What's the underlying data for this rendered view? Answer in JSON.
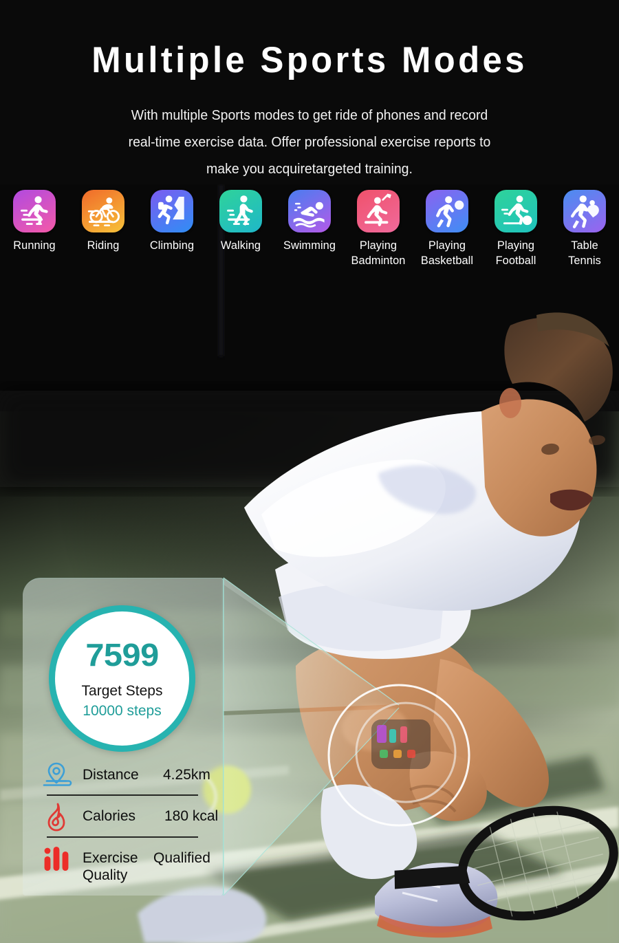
{
  "header": {
    "title": "Multiple Sports Modes",
    "subtitle_lines": [
      "With multiple Sports modes to get ride of phones and record",
      "real-time exercise data. Offer professional exercise reports to",
      "make you acquiretargeted training."
    ]
  },
  "sports": [
    {
      "label": "Running",
      "icon": "running-icon",
      "gradient_from": "#b14ae0",
      "gradient_to": "#f45aa8"
    },
    {
      "label": "Riding",
      "icon": "cycling-icon",
      "gradient_from": "#f06a2a",
      "gradient_to": "#f7c23a"
    },
    {
      "label": "Climbing",
      "icon": "climbing-icon",
      "gradient_from": "#7b5cf0",
      "gradient_to": "#2f8ef5"
    },
    {
      "label": "Walking",
      "icon": "walking-icon",
      "gradient_from": "#2fd39a",
      "gradient_to": "#1fb7c9"
    },
    {
      "label": "Swimming",
      "icon": "swimming-icon",
      "gradient_from": "#4a7df0",
      "gradient_to": "#b45ae8"
    },
    {
      "label": "Playing Badminton",
      "icon": "badminton-icon",
      "gradient_from": "#f0516b",
      "gradient_to": "#f06a9c"
    },
    {
      "label": "Playing Basketball",
      "icon": "basketball-icon",
      "gradient_from": "#8a63f0",
      "gradient_to": "#3f8ef5"
    },
    {
      "label": "Playing Football",
      "icon": "football-icon",
      "gradient_from": "#2fd39a",
      "gradient_to": "#1fc2bd"
    },
    {
      "label": "Table Tennis",
      "icon": "tabletennis-icon",
      "gradient_from": "#4a8df0",
      "gradient_to": "#9b63ef"
    }
  ],
  "hud": {
    "steps": {
      "value": "7599",
      "label": "Target Steps",
      "goal": "10000 steps",
      "ring_color": "#27b3b0",
      "value_color": "#1f9d99"
    },
    "stats": [
      {
        "icon": "location-pin-icon",
        "name": "Distance",
        "value": "4.25km",
        "icon_color": "#3d9fd6"
      },
      {
        "icon": "flame-icon",
        "name": "Calories",
        "value": "180 kcal",
        "icon_color": "#e03a35"
      },
      {
        "icon": "bar-chart-icon",
        "name": "Exercise",
        "name2": "Quality",
        "value": "Qualified",
        "icon_color": "#ec2d28"
      }
    ]
  },
  "theme": {
    "background": "#050505",
    "accent": "#27b3b0",
    "glass_edge": "#96e1d7"
  }
}
